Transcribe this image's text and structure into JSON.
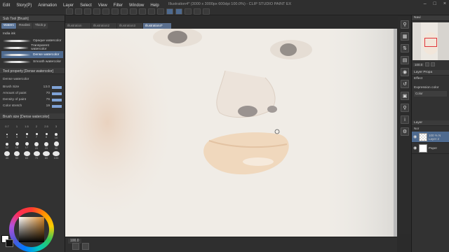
{
  "app": {
    "window_title": "Illustration4* (3000 x 3000px 600dpi 100.0%) - CLIP STUDIO PAINT EX"
  },
  "menubar": {
    "items": [
      "Edit",
      "Story(P)",
      "Animation",
      "Layer",
      "Select",
      "View",
      "Filter",
      "Window",
      "Help"
    ]
  },
  "document_tabs": [
    {
      "label": "Illustration",
      "active": false
    },
    {
      "label": "Illustration2",
      "active": false
    },
    {
      "label": "Illustration3",
      "active": false
    },
    {
      "label": "Illustration4*",
      "active": true
    }
  ],
  "sub_tool_panel": {
    "title": "Sub Tool [Brush]",
    "tabs": [
      {
        "label": "Waterc",
        "active": true
      },
      {
        "label": "Realisti",
        "active": false
      },
      {
        "label": "Thick p",
        "active": false
      }
    ],
    "brushes": [
      {
        "name": "India ink",
        "selected": false
      },
      {
        "name": "Opaque watercolor",
        "selected": false
      },
      {
        "name": "Transparent watercolor",
        "selected": false
      },
      {
        "name": "Dense watercolor",
        "selected": true
      },
      {
        "name": "Smooth watercolor",
        "selected": false
      }
    ]
  },
  "tool_property": {
    "title": "Tool property [Dense watercolor]",
    "preset_label": "Dense watercolor",
    "properties": [
      {
        "label": "Brush Size",
        "value": "13.0"
      },
      {
        "label": "Amount of paint",
        "value": "70"
      },
      {
        "label": "Density of paint",
        "value": "76"
      },
      {
        "label": "Color stretch",
        "value": "19"
      }
    ]
  },
  "brush_size_panel": {
    "title": "Brush size [Dense watercolor]",
    "sizes": [
      "0.7",
      "1",
      "1.5",
      "2",
      "2.5",
      "3",
      "4",
      "5",
      "6",
      "7",
      "8",
      "10",
      "12",
      "15",
      "17",
      "20",
      "25",
      "30",
      "40",
      "50",
      "60",
      "70",
      "80",
      "100"
    ]
  },
  "color": {
    "main": "#ffffff",
    "sub": "#111111",
    "hue_square_tint": "#d98a2b"
  },
  "bottom_bar": {
    "zoom": "100.0"
  },
  "right_tools": {
    "icons": [
      "zoom-icon",
      "grid-icon",
      "sort-icon",
      "layers-icon",
      "color-icon",
      "history-icon",
      "material-icon",
      "search-icon",
      "info-icon",
      "settings-icon"
    ]
  },
  "navigator": {
    "title": "Navi",
    "zoom": "100.0"
  },
  "layer_property": {
    "title": "Layer Propa",
    "effect_label": "Effect",
    "expression_color_label": "Expression color",
    "expression_color_value": "Color"
  },
  "layer_panel": {
    "title": "Layer",
    "blend_mode": "Nor",
    "layers": [
      {
        "name": "100 % N",
        "sublabel": "Layer 2",
        "selected": true
      },
      {
        "name": "Paper",
        "sublabel": "",
        "selected": false
      }
    ]
  }
}
